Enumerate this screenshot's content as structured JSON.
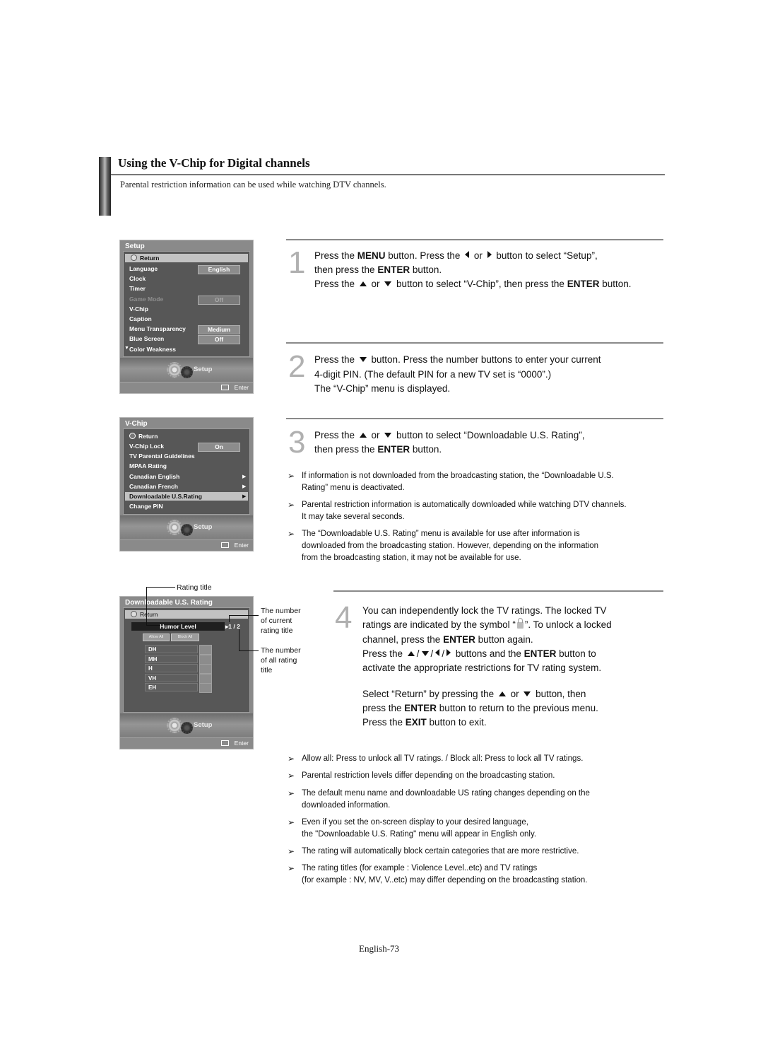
{
  "header": {
    "title": "Using the V-Chip for Digital channels",
    "intro": "Parental restriction information can be used while watching DTV channels."
  },
  "setup_menu": {
    "title": "Setup",
    "return_label": "Return",
    "items": [
      {
        "label": "Language",
        "value": "English"
      },
      {
        "label": "Clock",
        "value": ""
      },
      {
        "label": "Timer",
        "value": ""
      },
      {
        "label": "Game Mode",
        "value": "Off",
        "disabled": true
      },
      {
        "label": "V-Chip",
        "value": ""
      },
      {
        "label": "Caption",
        "value": ""
      },
      {
        "label": "Menu Transparency",
        "value": "Medium"
      },
      {
        "label": "Blue Screen",
        "value": "Off"
      },
      {
        "label": "Color Weakness",
        "value": ""
      }
    ],
    "more_indicator": "▼",
    "footer_label": "Setup",
    "enter_label": "Enter"
  },
  "vchip_menu": {
    "title": "V-Chip",
    "return_label": "Return",
    "items": [
      {
        "label": "V-Chip Lock",
        "value": "On"
      },
      {
        "label": "TV Parental Guidelines"
      },
      {
        "label": "MPAA Rating"
      },
      {
        "label": "Canadian English",
        "arrow": "▶"
      },
      {
        "label": "Canadian French",
        "arrow": "▶"
      },
      {
        "label": "Downloadable U.S.Rating",
        "arrow": "▶",
        "selected": true
      },
      {
        "label": "Change PIN"
      }
    ],
    "footer_label": "Setup",
    "enter_label": "Enter"
  },
  "rating_menu": {
    "title": "Downloadable U.S. Rating",
    "return_label": "Return",
    "rating_title": "Humor Level",
    "rating_count": "▸1 / 2",
    "allow_all": "Allow All",
    "block_all": "Block All",
    "ratings": [
      "DH",
      "MH",
      "H",
      "VH",
      "EH"
    ],
    "footer_label": "Setup",
    "enter_label": "Enter"
  },
  "callouts": {
    "rating_title": "Rating title",
    "current_number": [
      "The number",
      "of current",
      "rating title"
    ],
    "all_number": [
      "The number",
      "of all rating",
      "title"
    ]
  },
  "steps": [
    {
      "number": "1",
      "lines": [
        {
          "parts": [
            "Press the ",
            {
              "b": "MENU"
            },
            " button. Press the ",
            {
              "icon": "left"
            },
            " or ",
            {
              "icon": "right"
            },
            " button to select “Setup”,"
          ]
        },
        {
          "parts": [
            "then press the ",
            {
              "b": "ENTER"
            },
            " button."
          ]
        },
        {
          "parts": [
            "Press the ",
            {
              "icon": "up"
            },
            " or ",
            {
              "icon": "down"
            },
            " button to select “V-Chip”, then press the ",
            {
              "b": "ENTER"
            },
            " button."
          ]
        }
      ]
    },
    {
      "number": "2",
      "lines": [
        {
          "parts": [
            "Press the ",
            {
              "icon": "down"
            },
            " button. Press the number buttons to enter your current"
          ]
        },
        {
          "parts": [
            "4-digit PIN. (The default PIN for a new TV set is “0000”.)"
          ]
        },
        {
          "parts": [
            "The “V-Chip” menu is displayed."
          ]
        }
      ]
    },
    {
      "number": "3",
      "lines": [
        {
          "parts": [
            "Press the ",
            {
              "icon": "up"
            },
            " or ",
            {
              "icon": "down"
            },
            " button to select “Downloadable U.S. Rating”,"
          ]
        },
        {
          "parts": [
            "then press the ",
            {
              "b": "ENTER"
            },
            " button."
          ]
        }
      ]
    },
    {
      "number": "4",
      "lines": [
        {
          "parts": [
            "You can independently lock the TV ratings. The locked TV"
          ]
        },
        {
          "parts": [
            "ratings are indicated by the symbol “",
            {
              "icon": "lock"
            },
            "”. To unlock a locked"
          ]
        },
        {
          "parts": [
            "channel, press the ",
            {
              "b": "ENTER"
            },
            " button again."
          ]
        },
        {
          "parts": [
            "Press the ",
            {
              "icon": "up"
            },
            "/",
            {
              "icon": "down"
            },
            "/",
            {
              "icon": "left"
            },
            "/",
            {
              "icon": "right"
            },
            " buttons and the ",
            {
              "b": "ENTER"
            },
            " button to"
          ]
        },
        {
          "parts": [
            "activate the appropriate restrictions for TV rating system."
          ]
        },
        {
          "parts": [
            "Select “Return” by pressing the ",
            {
              "icon": "up"
            },
            " or ",
            {
              "icon": "down"
            },
            " button, then"
          ]
        },
        {
          "parts": [
            "press the ",
            {
              "b": "ENTER"
            },
            " button to return to the previous menu."
          ]
        },
        {
          "parts": [
            "Press the ",
            {
              "b": "EXIT"
            },
            " button to exit."
          ]
        }
      ]
    }
  ],
  "notes_a": [
    [
      "If information is not downloaded from the broadcasting station, the “Downloadable U.S.",
      "Rating” menu is deactivated."
    ],
    [
      "Parental restriction information is automatically downloaded while watching DTV channels.",
      "It may take several seconds."
    ],
    [
      "The “Downloadable U.S. Rating” menu is available for use after information is",
      "downloaded from the broadcasting station. However, depending on the information",
      "from the broadcasting station, it may not be available for use."
    ]
  ],
  "notes_b": [
    [
      "Allow all: Press to unlock all TV ratings. / Block all: Press to lock all TV ratings."
    ],
    [
      "Parental restriction levels differ depending on the broadcasting station."
    ],
    [
      "The default menu name and downloadable US rating changes depending on the",
      "downloaded information."
    ],
    [
      "Even if you set the on-screen display to your desired language,",
      "the \"Downloadable U.S. Rating\" menu will appear in English only."
    ],
    [
      "The rating will automatically block certain categories that are more restrictive."
    ],
    [
      "The rating titles (for example : Violence Level..etc) and TV ratings",
      "(for example : NV, MV, V..etc) may differ depending on the broadcasting station."
    ]
  ],
  "note_arrow": "➢",
  "page_number": "English-73"
}
